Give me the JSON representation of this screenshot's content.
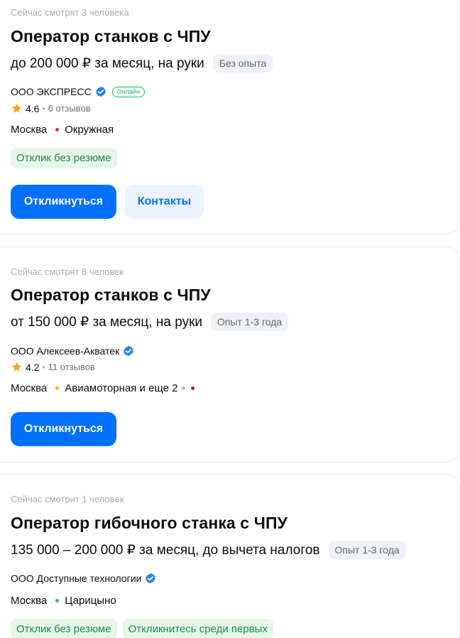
{
  "colors": {
    "accent": "#0070ff",
    "verified": "#2f80ed",
    "online": "#0dc268",
    "green_tag_bg": "#e6f7ea",
    "green_tag_text": "#1c8b41",
    "star": "#f5a623"
  },
  "icons": {
    "verified": "verified-check-icon",
    "star": "star-icon"
  },
  "vacancies": [
    {
      "viewers": "Сейчас смотрят 3 человека",
      "title": "Оператор станков с ЧПУ",
      "salary": "до 200 000 ₽ за месяц, на руки",
      "experience": "Без опыта",
      "company": "ООО ЭКСПРЕСС",
      "online_badge": "Онлайн",
      "rating": "4.6",
      "reviews": "6 отзывов",
      "city": "Москва",
      "metro": "Окружная",
      "tags": [
        "Отклик без резюме"
      ],
      "respond_label": "Откликнуться",
      "contacts_label": "Контакты"
    },
    {
      "viewers": "Сейчас смотрят 8 человек",
      "title": "Оператор станков с ЧПУ",
      "salary": "от 150 000 ₽ за месяц, на руки",
      "experience": "Опыт 1-3 года",
      "company": "ООО Алексеев-Акватек",
      "rating": "4.2",
      "reviews": "11 отзывов",
      "city": "Москва",
      "metro": "Авиамоторная и еще 2",
      "respond_label": "Откликнуться"
    },
    {
      "viewers": "Сейчас смотрит 1 человек",
      "title": "Оператор гибочного станка с ЧПУ",
      "salary": "135 000 – 200 000 ₽ за месяц, до вычета налогов",
      "experience": "Опыт 1-3 года",
      "company": "ООО Доступные технологии",
      "city": "Москва",
      "metro": "Царицыно",
      "tags": [
        "Отклик без резюме",
        "Откликнитесь среди первых"
      ]
    }
  ]
}
